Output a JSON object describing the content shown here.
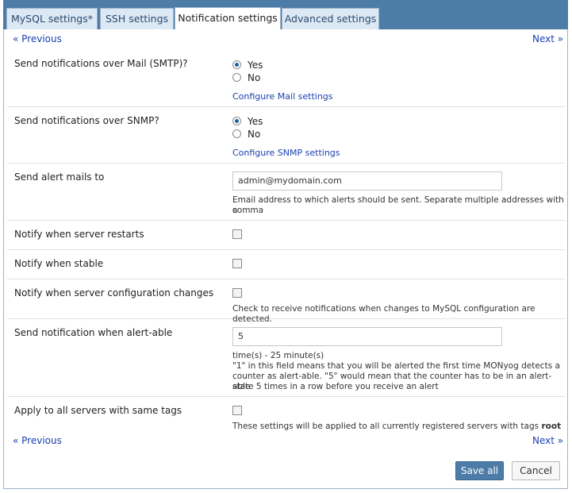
{
  "tabs": [
    {
      "label": "MySQL settings*"
    },
    {
      "label": "SSH settings"
    },
    {
      "label": "Notification settings"
    },
    {
      "label": "Advanced settings"
    }
  ],
  "nav": {
    "previous": "« Previous",
    "next": "Next »"
  },
  "mail": {
    "label": "Send notifications over Mail (SMTP)?",
    "yes": "Yes",
    "no": "No",
    "configure_link": "Configure Mail settings"
  },
  "snmp": {
    "label": "Send notifications over SNMP?",
    "yes": "Yes",
    "no": "No",
    "configure_link": "Configure SNMP settings"
  },
  "alert_mails": {
    "label": "Send alert mails to",
    "value": "admin@mydomain.com",
    "help": "Email address to which alerts should be sent. Separate multiple addresses with a",
    "help2": "comma"
  },
  "restart": {
    "label": "Notify when server restarts"
  },
  "stable": {
    "label": "Notify when stable"
  },
  "config_change": {
    "label": "Notify when server configuration changes",
    "help": "Check to receive notifications when changes to MySQL configuration are detected."
  },
  "alertable": {
    "label": "Send notification when alert-able",
    "value": "5",
    "help1": "time(s) - 25 minute(s)",
    "help2": "\"1\" in this field means that you will be alerted the first time MONyog detects a",
    "help3": "counter as alert-able. \"5\" would mean that the counter has to be in an alert-able",
    "help4": "state 5 times in a row before you receive an alert"
  },
  "apply_all": {
    "label": "Apply to all servers with same tags",
    "help": "These settings will be applied to all currently registered servers with tags",
    "tag": "root"
  },
  "buttons": {
    "save": "Save all",
    "cancel": "Cancel"
  }
}
